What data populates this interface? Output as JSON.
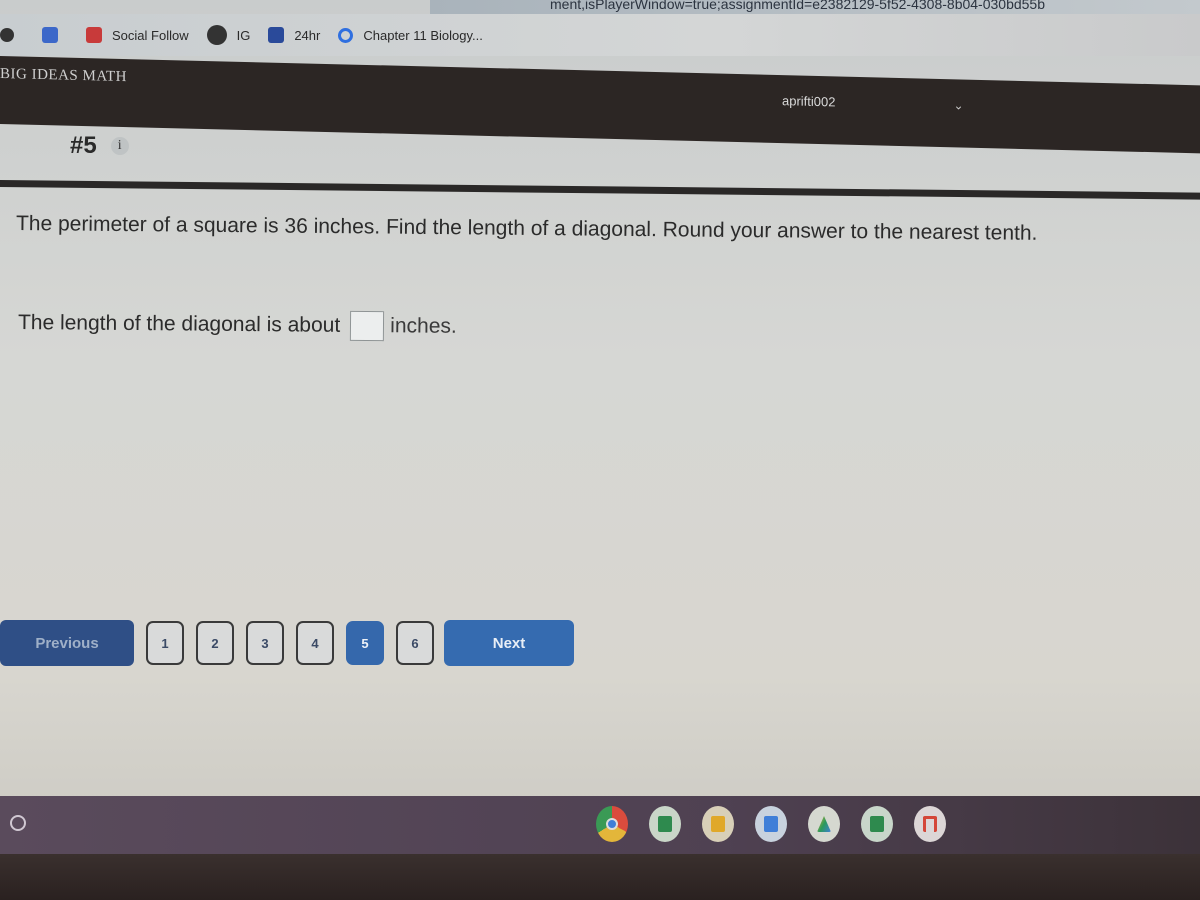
{
  "browser": {
    "url_fragment": "ment,isPlayerWindow=true;assignmentId=e2382129-5f52-4308-8b04-030bd55b",
    "bookmarks": [
      {
        "label": "",
        "icon": "globe-icon"
      },
      {
        "label": "",
        "icon": "docs-icon"
      },
      {
        "label": "Social Follow",
        "icon": "social-icon"
      },
      {
        "label": "IG",
        "icon": "ig-icon"
      },
      {
        "label": "24hr",
        "icon": "bookmark-24hr-icon"
      },
      {
        "label": "Chapter 11 Biology...",
        "icon": "quizlet-icon"
      }
    ]
  },
  "header": {
    "brand": "BIG IDEAS MATH",
    "username": "aprifti002",
    "menu_icon": "chevron-down-icon"
  },
  "question": {
    "number": "#5",
    "info_icon_glyph": "i",
    "prompt": "The perimeter of a square is 36 inches. Find the length of a diagonal. Round your answer to the nearest tenth.",
    "answer_prefix": "The length of the diagonal is about",
    "answer_value": "",
    "answer_suffix": "inches."
  },
  "navigation": {
    "previous_label": "Previous",
    "next_label": "Next",
    "pages": [
      "1",
      "2",
      "3",
      "4",
      "5",
      "6"
    ],
    "current_page": "5"
  },
  "shelf": {
    "apps": [
      {
        "name": "Chrome",
        "icon": "chrome-icon",
        "color": "#d94c3d"
      },
      {
        "name": "Classroom",
        "icon": "classroom-icon",
        "color": "#2e8a4e"
      },
      {
        "name": "Slides",
        "icon": "slides-icon",
        "color": "#e0a82a"
      },
      {
        "name": "Docs",
        "icon": "docs-icon",
        "color": "#3f7ed8"
      },
      {
        "name": "Drive",
        "icon": "drive-icon",
        "color": "#2a9a5a"
      },
      {
        "name": "Sheets",
        "icon": "sheets-icon",
        "color": "#2e8a4e"
      },
      {
        "name": "Gmail",
        "icon": "gmail-icon",
        "color": "#d44638"
      }
    ]
  }
}
